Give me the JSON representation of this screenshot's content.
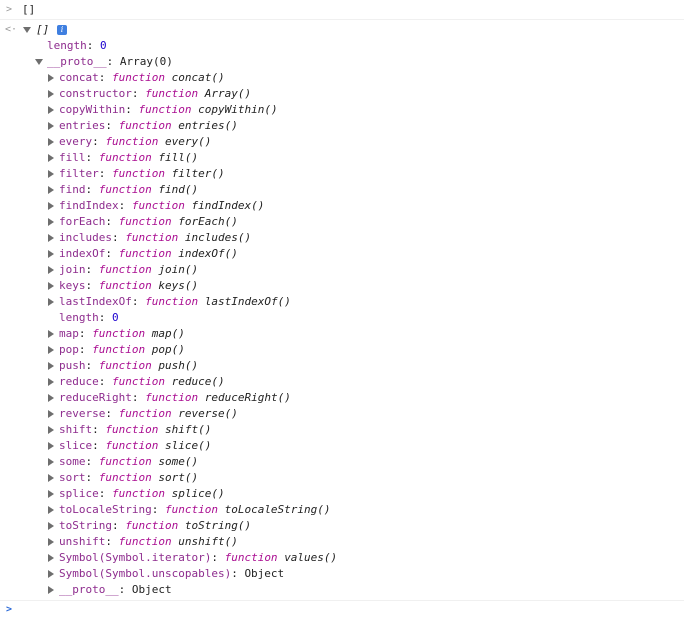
{
  "command": "[]",
  "result": {
    "summary": "[]",
    "info_badge": "i",
    "length_key": "length",
    "length_value": "0",
    "proto_key": "__proto__",
    "proto_value": "Array(0)"
  },
  "members": [
    {
      "key": "concat",
      "kind": "function",
      "fn": "concat()"
    },
    {
      "key": "constructor",
      "kind": "function",
      "fn": "Array()"
    },
    {
      "key": "copyWithin",
      "kind": "function",
      "fn": "copyWithin()"
    },
    {
      "key": "entries",
      "kind": "function",
      "fn": "entries()"
    },
    {
      "key": "every",
      "kind": "function",
      "fn": "every()"
    },
    {
      "key": "fill",
      "kind": "function",
      "fn": "fill()"
    },
    {
      "key": "filter",
      "kind": "function",
      "fn": "filter()"
    },
    {
      "key": "find",
      "kind": "function",
      "fn": "find()"
    },
    {
      "key": "findIndex",
      "kind": "function",
      "fn": "findIndex()"
    },
    {
      "key": "forEach",
      "kind": "function",
      "fn": "forEach()"
    },
    {
      "key": "includes",
      "kind": "function",
      "fn": "includes()"
    },
    {
      "key": "indexOf",
      "kind": "function",
      "fn": "indexOf()"
    },
    {
      "key": "join",
      "kind": "function",
      "fn": "join()"
    },
    {
      "key": "keys",
      "kind": "function",
      "fn": "keys()"
    },
    {
      "key": "lastIndexOf",
      "kind": "function",
      "fn": "lastIndexOf()"
    },
    {
      "key": "length",
      "kind": "number",
      "value": "0"
    },
    {
      "key": "map",
      "kind": "function",
      "fn": "map()"
    },
    {
      "key": "pop",
      "kind": "function",
      "fn": "pop()"
    },
    {
      "key": "push",
      "kind": "function",
      "fn": "push()"
    },
    {
      "key": "reduce",
      "kind": "function",
      "fn": "reduce()"
    },
    {
      "key": "reduceRight",
      "kind": "function",
      "fn": "reduceRight()"
    },
    {
      "key": "reverse",
      "kind": "function",
      "fn": "reverse()"
    },
    {
      "key": "shift",
      "kind": "function",
      "fn": "shift()"
    },
    {
      "key": "slice",
      "kind": "function",
      "fn": "slice()"
    },
    {
      "key": "some",
      "kind": "function",
      "fn": "some()"
    },
    {
      "key": "sort",
      "kind": "function",
      "fn": "sort()"
    },
    {
      "key": "splice",
      "kind": "function",
      "fn": "splice()"
    },
    {
      "key": "toLocaleString",
      "kind": "function",
      "fn": "toLocaleString()"
    },
    {
      "key": "toString",
      "kind": "function",
      "fn": "toString()"
    },
    {
      "key": "unshift",
      "kind": "function",
      "fn": "unshift()"
    },
    {
      "key": "Symbol(Symbol.iterator)",
      "kind": "function",
      "fn": "values()"
    },
    {
      "key": "Symbol(Symbol.unscopables)",
      "kind": "object",
      "value": "Object"
    },
    {
      "key": "__proto__",
      "kind": "object",
      "value": "Object"
    }
  ],
  "labels": {
    "function_keyword": "function"
  },
  "colors": {
    "key": "#8e2c8e",
    "keyword": "#aa0d91",
    "number": "#1c00cf",
    "prompt": "#2d6bd8"
  }
}
